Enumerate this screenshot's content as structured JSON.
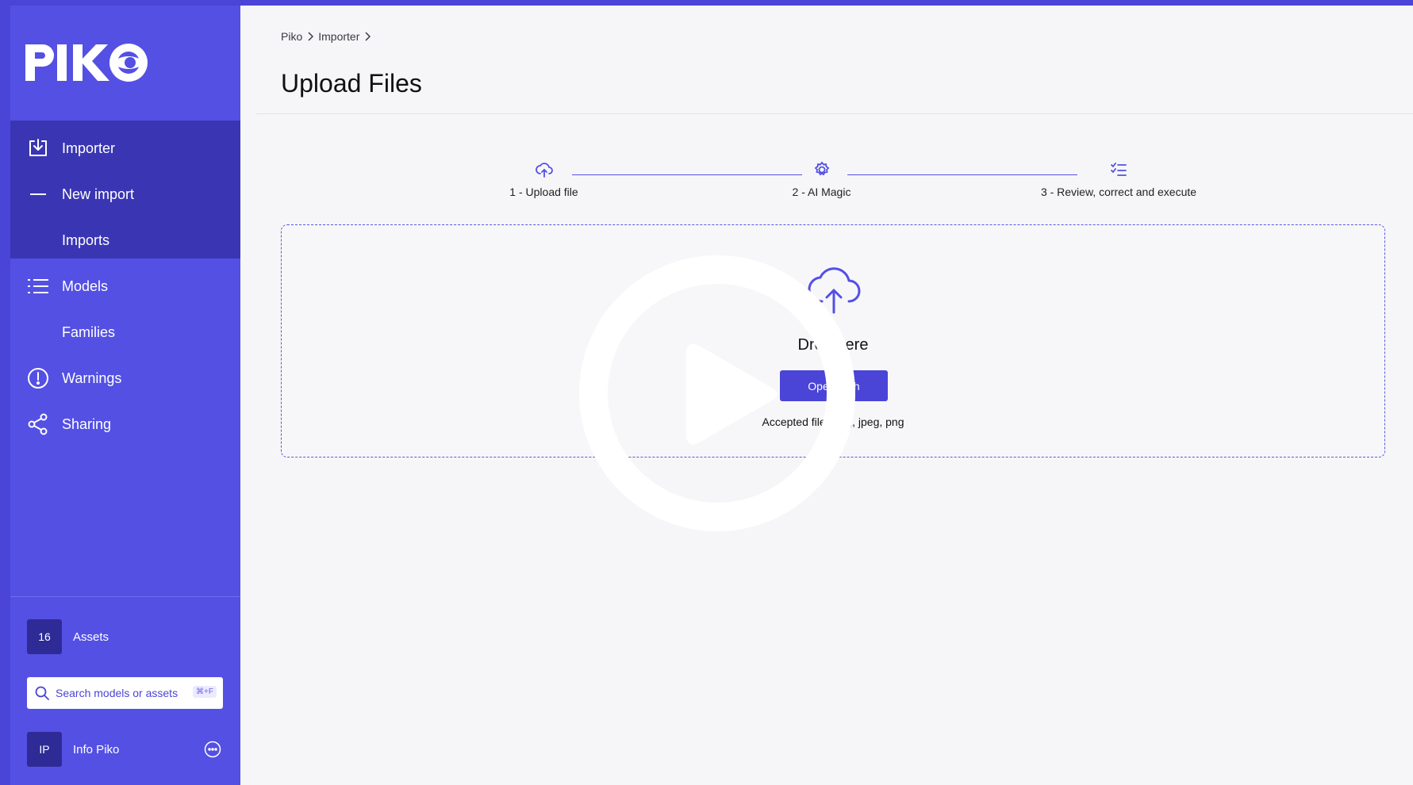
{
  "sidebar": {
    "logo_text": "PIKO",
    "items": [
      {
        "label": "Importer",
        "icon": "import-icon"
      },
      {
        "label": "New import",
        "icon": "dash-icon"
      },
      {
        "label": "Imports"
      },
      {
        "label": "Models",
        "icon": "list-icon"
      },
      {
        "label": "Families"
      },
      {
        "label": "Warnings",
        "icon": "alert-circle-icon"
      },
      {
        "label": "Sharing",
        "icon": "share-icon"
      }
    ],
    "assets": {
      "count": "16",
      "label": "Assets"
    },
    "search": {
      "placeholder": "Search models or assets",
      "shortcut": "⌘+F"
    },
    "user": {
      "initials": "IP",
      "name": "Info Piko"
    }
  },
  "breadcrumb": [
    "Piko",
    "Importer"
  ],
  "page": {
    "title": "Upload Files"
  },
  "stepper": {
    "steps": [
      {
        "label": "1 - Upload file",
        "icon": "cloud-upload-icon"
      },
      {
        "label": "2 - AI Magic",
        "icon": "gear-icon"
      },
      {
        "label": "3 - Review, correct and execute",
        "icon": "checklist-icon"
      }
    ]
  },
  "dropzone": {
    "title": "Drop here",
    "button": "Open path",
    "accepted": "Accepted files: jpg, jpeg, png"
  },
  "overlay": {
    "icon": "play-icon"
  },
  "colors": {
    "accent": "#4a45d6",
    "sidebar": "#5450e4",
    "sidebar_active": "#3a36b3"
  }
}
